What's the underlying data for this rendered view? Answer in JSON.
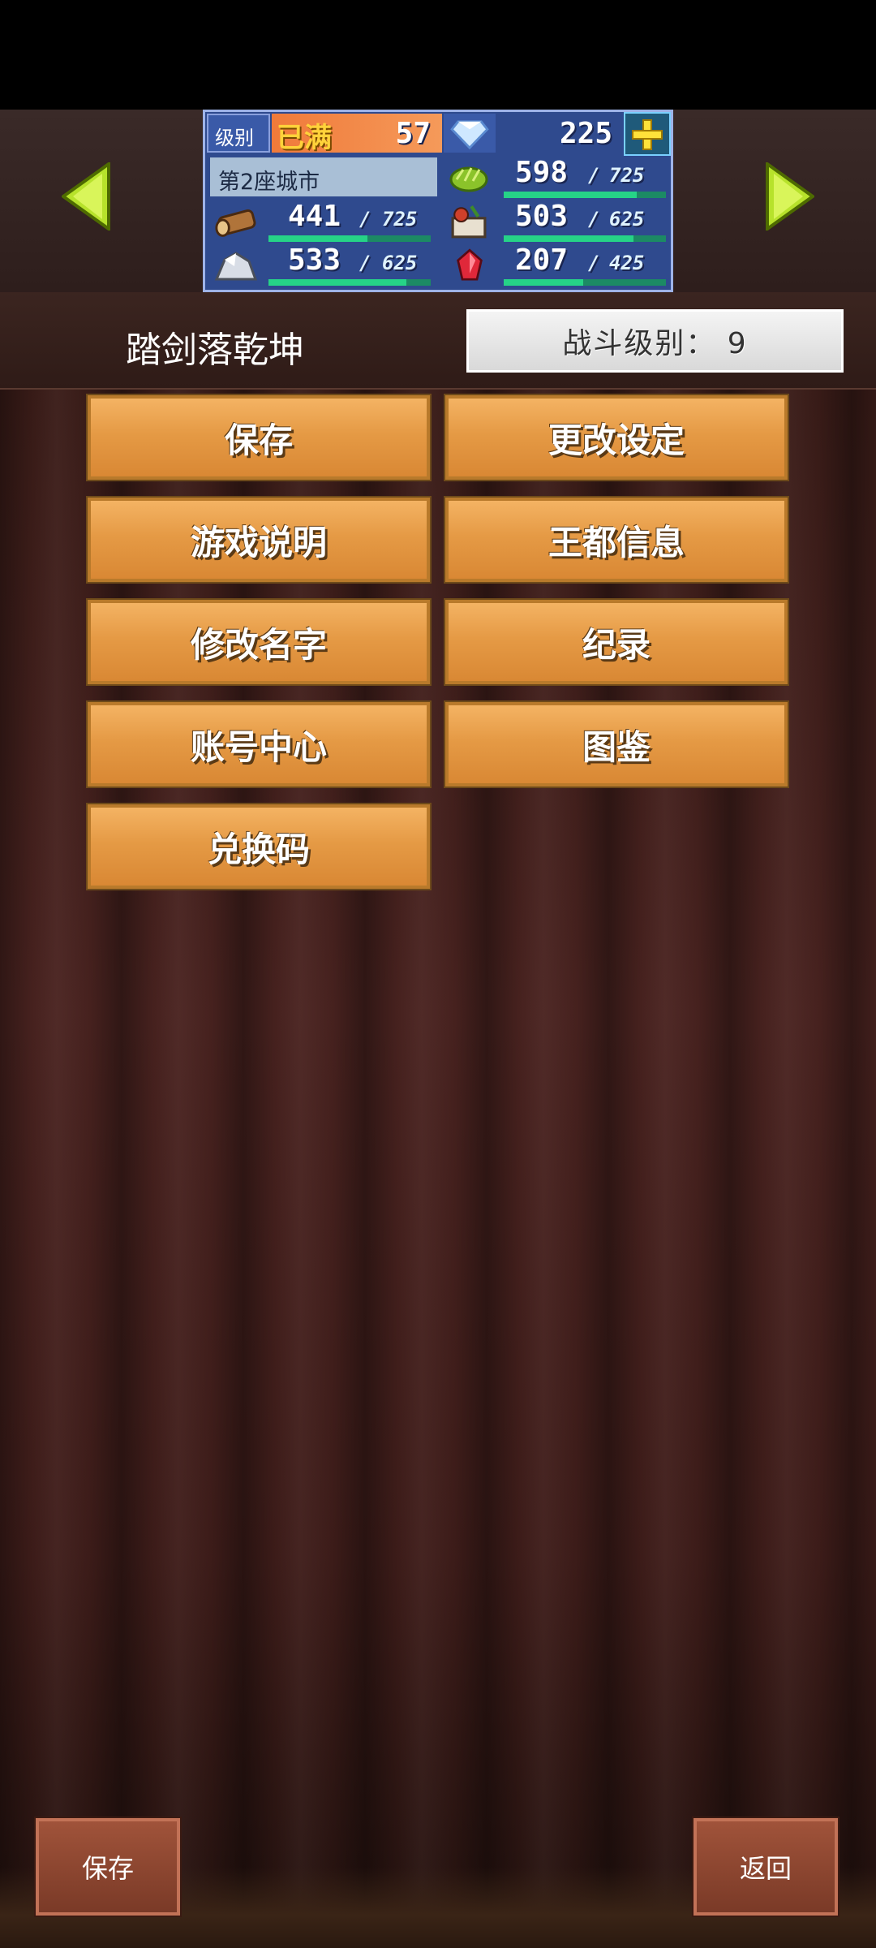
{
  "header": {
    "level_label": "级别",
    "max_badge": "已满",
    "level_value": "57",
    "gems": "225",
    "city_name": "第2座城市",
    "resources": [
      {
        "icon": "grass-icon",
        "value": "598",
        "max": "725",
        "fill": 0.82
      },
      {
        "icon": "wood-log-icon",
        "value": "441",
        "max": "725",
        "fill": 0.61
      },
      {
        "icon": "food-basket-icon",
        "value": "503",
        "max": "625",
        "fill": 0.8
      },
      {
        "icon": "stone-ore-icon",
        "value": "533",
        "max": "625",
        "fill": 0.85
      },
      {
        "icon": "ruby-icon",
        "value": "207",
        "max": "425",
        "fill": 0.49
      }
    ],
    "separator": "/"
  },
  "player": {
    "name": "踏剑落乾坤",
    "battle_level": "战斗级别：  9"
  },
  "menu": {
    "save": "保存",
    "change_settings": "更改设定",
    "game_guide": "游戏说明",
    "capital_info": "王都信息",
    "rename": "修改名字",
    "records": "纪录",
    "account_center": "账号中心",
    "encyclopedia": "图鉴",
    "redeem_code": "兑换码"
  },
  "bottom": {
    "save": "保存",
    "back": "返回"
  },
  "colors": {
    "menu_button": "#e59a45",
    "panel_blue": "#2f4a8e",
    "bar_green": "#26d387"
  }
}
